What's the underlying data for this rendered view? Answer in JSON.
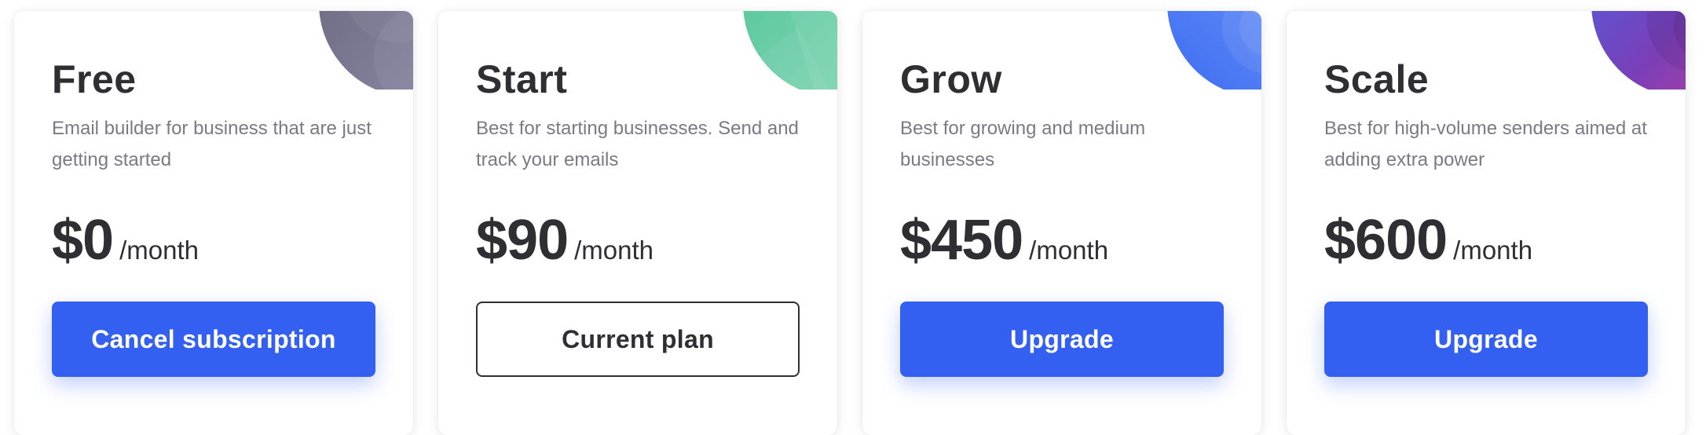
{
  "plans": [
    {
      "name": "Free",
      "description": "Email builder for business that are just getting started",
      "price": "$0",
      "period": "/month",
      "button_label": "Cancel subscription",
      "button_style": "primary",
      "accent_colors": [
        "#6b6b80",
        "#8d8aa8"
      ]
    },
    {
      "name": "Start",
      "description": "Best for starting businesses. Send and track your emails",
      "price": "$90",
      "period": "/month",
      "button_label": "Current plan",
      "button_style": "outline",
      "accent_colors": [
        "#57c79a",
        "#86d6b4"
      ]
    },
    {
      "name": "Grow",
      "description": "Best for growing and medium businesses",
      "price": "$450",
      "period": "/month",
      "button_label": "Upgrade",
      "button_style": "primary",
      "accent_colors": [
        "#3e6ef2",
        "#7da0ff"
      ]
    },
    {
      "name": "Scale",
      "description": "Best for high-volume senders aimed at adding extra power",
      "price": "$600",
      "period": "/month",
      "button_label": "Upgrade",
      "button_style": "primary",
      "accent_colors": [
        "#4e5fe0",
        "#b0409a"
      ]
    }
  ],
  "colors": {
    "primary": "#3360f0",
    "text": "#2f2f33",
    "muted": "#7a7a85"
  }
}
